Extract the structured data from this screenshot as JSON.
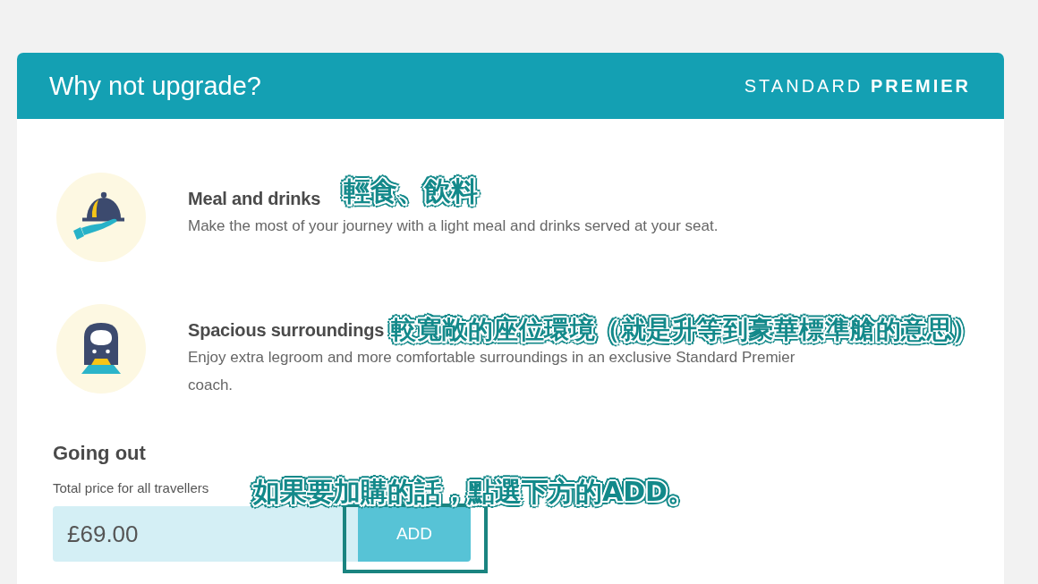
{
  "card": {
    "title": "Why not upgrade?",
    "brand": "STANDARD **PREMIER**"
  },
  "features": [
    {
      "kind": "meal",
      "title": "Meal and drinks",
      "note": "輕食、飲料",
      "description": "Make the most of your journey with a light meal and drinks served at your seat."
    },
    {
      "kind": "train",
      "title": "Spacious surroundings",
      "note": "較寬敞的座位環境（就是升等到豪華標準艙的意思）",
      "description": "Enjoy extra legroom and more comfortable surroundings in an exclusive Standard Premier coach."
    }
  ],
  "going_out": {
    "heading": "Going out",
    "label": "Total price for all travellers",
    "price": "£69.00",
    "button": "ADD",
    "note": "如果要加購的話，點選下方的ADD。",
    "button_highlighted": true
  }
}
